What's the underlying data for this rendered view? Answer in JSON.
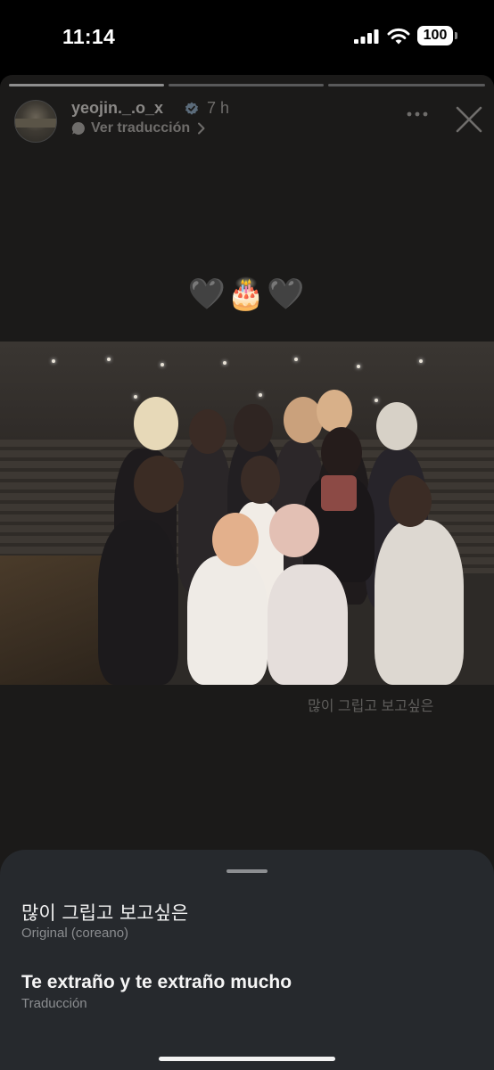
{
  "status_bar": {
    "time": "11:14",
    "battery": "100"
  },
  "story": {
    "username": "yeojin._.o_x",
    "time_ago": "7 h",
    "translate_link": "Ver traducción",
    "emojis": "🖤🎂🖤",
    "photo_caption": "많이 그립고 보고싶은"
  },
  "translation_sheet": {
    "original_text": "많이 그립고 보고싶은",
    "original_label": "Original (coreano)",
    "translated_text": "Te extraño y te extraño mucho",
    "translated_label": "Traducción"
  },
  "colors": {
    "background": "#000000",
    "story_bg": "#1b1a19",
    "sheet_bg": "#26292d",
    "accent": "#ffffff"
  },
  "icons": [
    "signal-icon",
    "wifi-icon",
    "battery-icon",
    "verified-icon",
    "translate-icon",
    "chevron-right-icon",
    "more-icon",
    "close-icon"
  ]
}
